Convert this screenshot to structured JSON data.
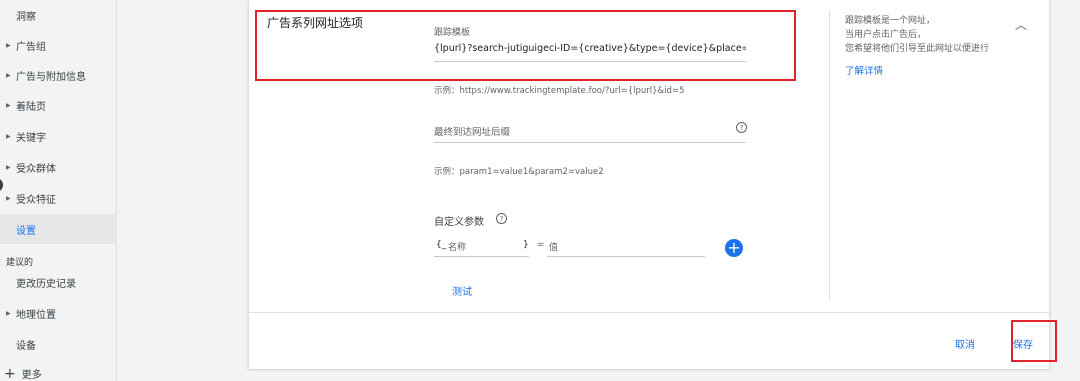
{
  "sidebar": {
    "items": [
      {
        "label": "洞察"
      },
      {
        "label": "广告组"
      },
      {
        "label": "广告与附加信息"
      },
      {
        "label": "着陆页"
      },
      {
        "label": "关键字"
      },
      {
        "label": "受众群体"
      },
      {
        "label": "受众特征"
      },
      {
        "label": "设置"
      },
      {
        "label": "更改历史记录"
      },
      {
        "label": "地理位置"
      },
      {
        "label": "设备"
      }
    ],
    "section_label": "建议的",
    "more_label": "更多"
  },
  "card": {
    "title": "广告系列网址选项",
    "tracking_template": {
      "label": "跟踪模板",
      "value": "{lpurl}?search-jutiguigeci-ID={creative}&type={device}&place={placem",
      "example": "示例：https://www.trackingtemplate.foo/?url={lpurl}&id=5"
    },
    "final_url_suffix": {
      "placeholder": "最终到达网址后缀",
      "example": "示例：param1=value1&param2=value2"
    },
    "custom_params": {
      "label": "自定义参数",
      "name_prefix": "{_",
      "name_placeholder": "名称",
      "name_suffix": "}",
      "equals": "=",
      "value_placeholder": "值"
    },
    "test_label": "测试",
    "side_note": {
      "line1": "跟踪模板是一个网址，",
      "line2": "当用户点击广告后，",
      "line3": "您希望将他们引导至此网址以便进行",
      "link": "了解详情"
    },
    "cancel_label": "取消",
    "save_label": "保存"
  },
  "colors": {
    "accent": "#1a73e8",
    "highlight": "#e0222a"
  }
}
